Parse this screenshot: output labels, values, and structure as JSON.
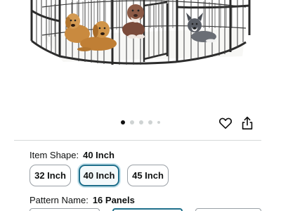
{
  "carousel": {
    "total": 5,
    "active_index": 0
  },
  "actions": {
    "heart_icon": "heart-icon",
    "share_icon": "share-icon"
  },
  "item_shape": {
    "label": "Item Shape:",
    "value": "40 Inch",
    "options": [
      "32 Inch",
      "40 Inch",
      "45 Inch"
    ],
    "selected": "40 Inch"
  },
  "pattern_name": {
    "label": "Pattern Name:",
    "value": "16 Panels"
  },
  "colors": {
    "accent": "#1f6f8b",
    "fence": "#2b2b2b"
  }
}
